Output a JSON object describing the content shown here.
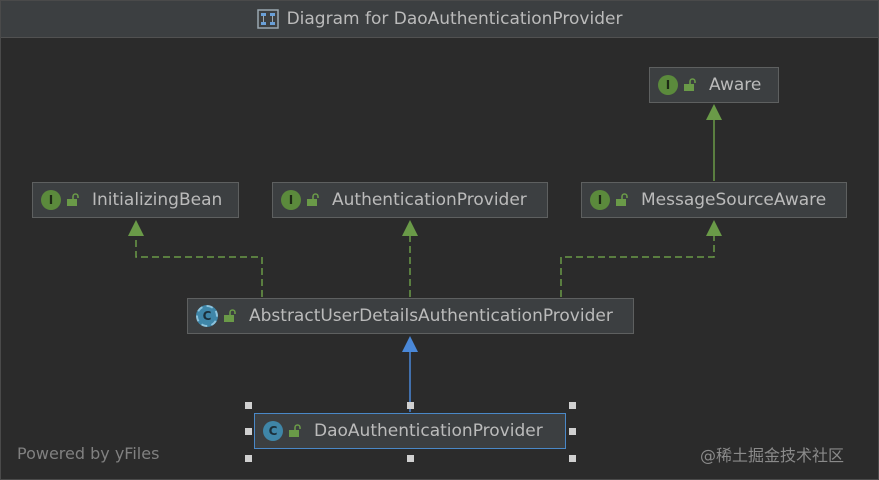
{
  "window": {
    "title": "Diagram for DaoAuthenticationProvider"
  },
  "nodes": {
    "aware": {
      "label": "Aware",
      "kind": "interface",
      "badge": "I"
    },
    "initializing_bean": {
      "label": "InitializingBean",
      "kind": "interface",
      "badge": "I"
    },
    "authentication_provider": {
      "label": "AuthenticationProvider",
      "kind": "interface",
      "badge": "I"
    },
    "message_source_aware": {
      "label": "MessageSourceAware",
      "kind": "interface",
      "badge": "I"
    },
    "abstract_user_details": {
      "label": "AbstractUserDetailsAuthenticationProvider",
      "kind": "abstract-class",
      "badge": "C"
    },
    "dao_authentication_provider": {
      "label": "DaoAuthenticationProvider",
      "kind": "class",
      "badge": "C",
      "selected": true
    }
  },
  "edges": [
    {
      "from": "message_source_aware",
      "to": "aware",
      "type": "extends"
    },
    {
      "from": "abstract_user_details",
      "to": "initializing_bean",
      "type": "implements"
    },
    {
      "from": "abstract_user_details",
      "to": "authentication_provider",
      "type": "implements"
    },
    {
      "from": "abstract_user_details",
      "to": "message_source_aware",
      "type": "implements"
    },
    {
      "from": "dao_authentication_provider",
      "to": "abstract_user_details",
      "type": "extends"
    }
  ],
  "footer": {
    "powered_by": "Powered by yFiles",
    "watermark": "@稀土掘金技术社区"
  },
  "colors": {
    "interface_edge": "#6a9a48",
    "class_edge": "#4a88d8",
    "selection_border": "#4a88c7"
  }
}
